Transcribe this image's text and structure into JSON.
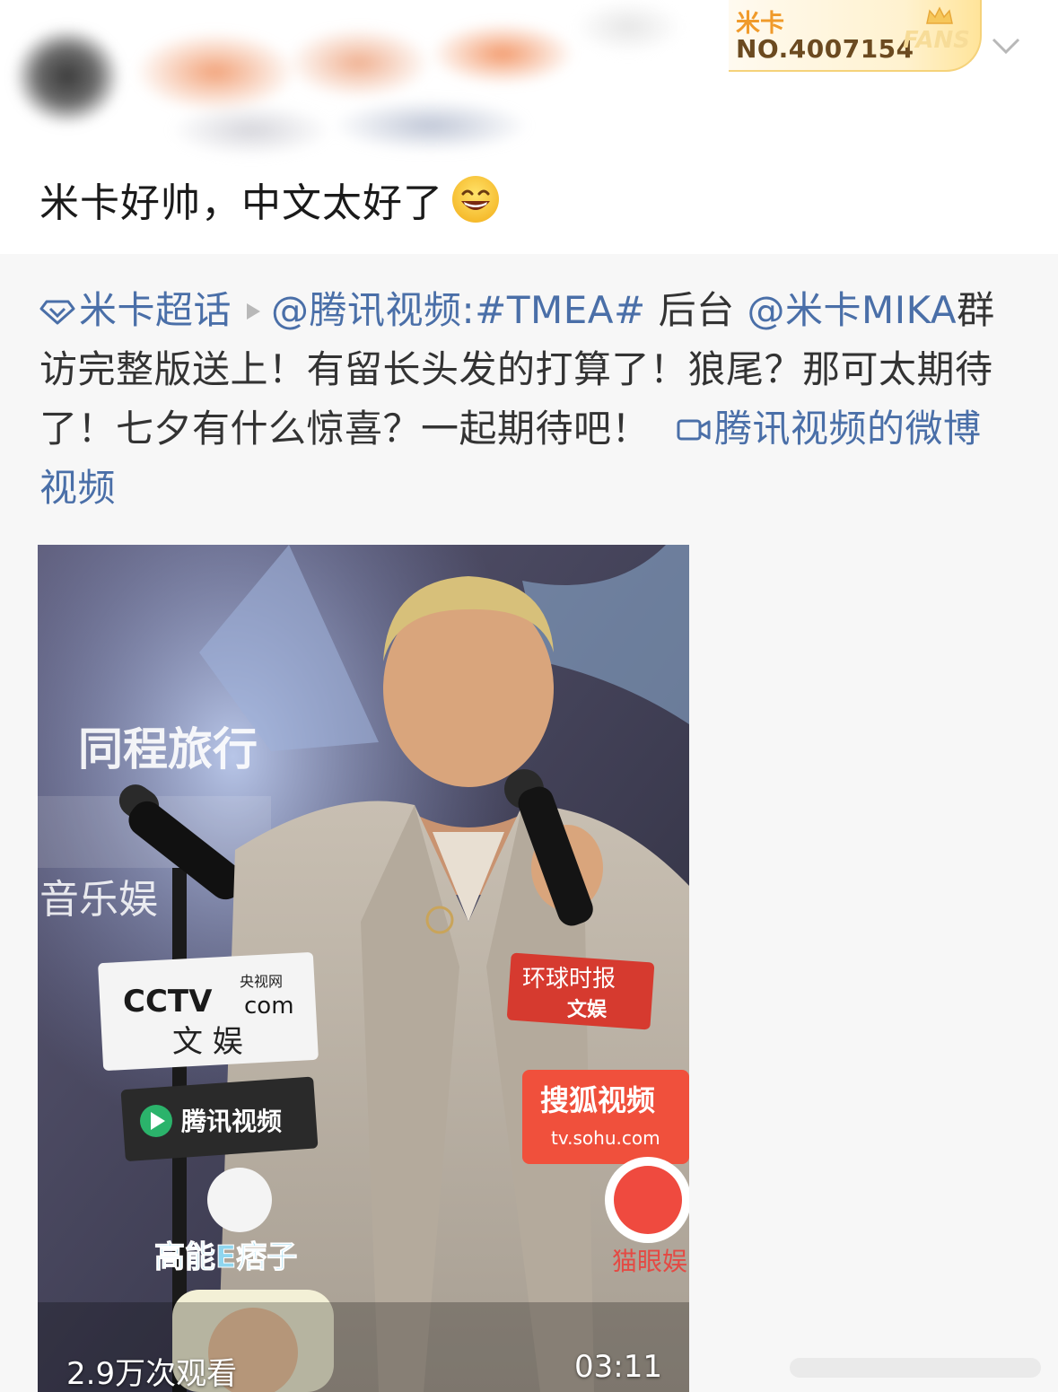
{
  "header": {
    "fans_name": "米卡",
    "fans_number": "NO.4007154",
    "fans_label": "FANS",
    "icons": [
      "crown-icon",
      "chevron-down-icon"
    ]
  },
  "post": {
    "text": "米卡好帅，中文太好了",
    "emoji": "grinning-face-icon"
  },
  "repost": {
    "topic": "米卡超话",
    "mention_source": "@腾讯视频",
    "hashtag": ":#TMEA#",
    "backstage": " 后台",
    "mention_star": "@米卡MIKA",
    "body": "群访完整版送上！有留长头发的打算了！狼尾？那可太期待了！七夕有什么惊喜？一起期待吧！",
    "video_link": "腾讯视频的微博视频"
  },
  "video": {
    "views": "2.9万次观看",
    "duration": "03:11",
    "sign_tongcheng": "同程旅行",
    "sign_music": "音乐娱",
    "sign_cctv_sub": "央视网",
    "sign_cctv_com": "com",
    "sign_cctv_wenyu": "文 娱",
    "sign_tencent": "腾讯视频",
    "sign_global": "环球时报",
    "sign_global_sub": "文娱",
    "sign_sohu": "搜狐视频",
    "sign_sohu_url": "tv.sohu.com",
    "sign_gaoneng": "高能E痞子",
    "sign_maoyan": "猫眼娱"
  },
  "colors": {
    "link": "#4a6fa8",
    "fans_orange": "#f09a2a",
    "repost_bg": "#f7f7f7"
  }
}
